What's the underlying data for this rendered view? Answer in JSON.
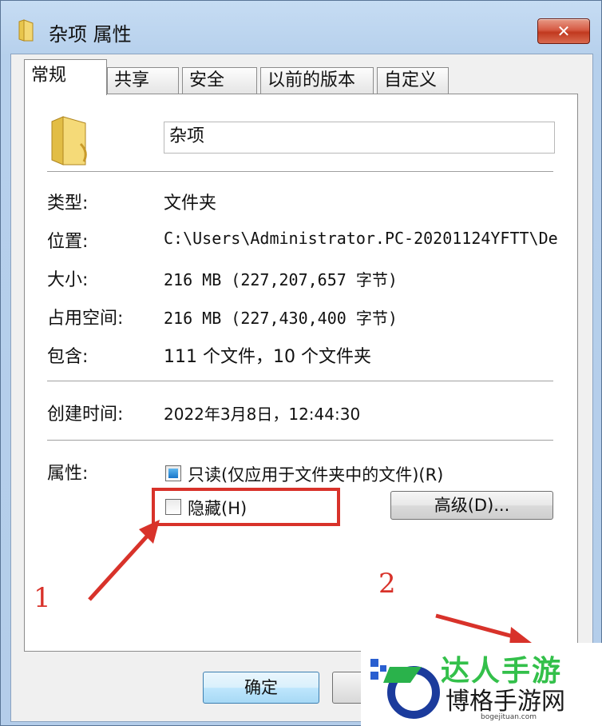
{
  "window": {
    "title": "杂项 属性",
    "close_glyph": "✕"
  },
  "tabs": [
    {
      "label": "常规",
      "active": true
    },
    {
      "label": "共享",
      "active": false
    },
    {
      "label": "安全",
      "active": false
    },
    {
      "label": "以前的版本",
      "active": false
    },
    {
      "label": "自定义",
      "active": false
    }
  ],
  "general": {
    "folder_name": "杂项",
    "rows": [
      {
        "label": "类型:",
        "value": "文件夹"
      },
      {
        "label": "位置:",
        "value": "C:\\Users\\Administrator.PC-20201124YFTT\\De"
      },
      {
        "label": "大小:",
        "value": "216 MB (227,207,657 字节)"
      },
      {
        "label": "占用空间:",
        "value": "216 MB (227,430,400 字节)"
      },
      {
        "label": "包含:",
        "value": "111 个文件，10 个文件夹"
      },
      {
        "label": "创建时间:",
        "value": "2022年3月8日，12:44:30"
      }
    ],
    "attributes_label": "属性:",
    "readonly_label": "只读(仅应用于文件夹中的文件)(R)",
    "readonly_checked": true,
    "hidden_label": "隐藏(H)",
    "hidden_checked": false,
    "advanced_button": "高级(D)..."
  },
  "buttons": {
    "ok": "确定",
    "cancel": ""
  },
  "annotations": {
    "marker_1": "1",
    "marker_2": "2",
    "color": "#d8322a"
  },
  "watermark": {
    "green_text": "达人手游",
    "main_text": "博格手游网",
    "url": "bogejituan.com"
  },
  "icons": {
    "title": "folder-icon",
    "big": "folder-icon",
    "close": "close-icon"
  }
}
